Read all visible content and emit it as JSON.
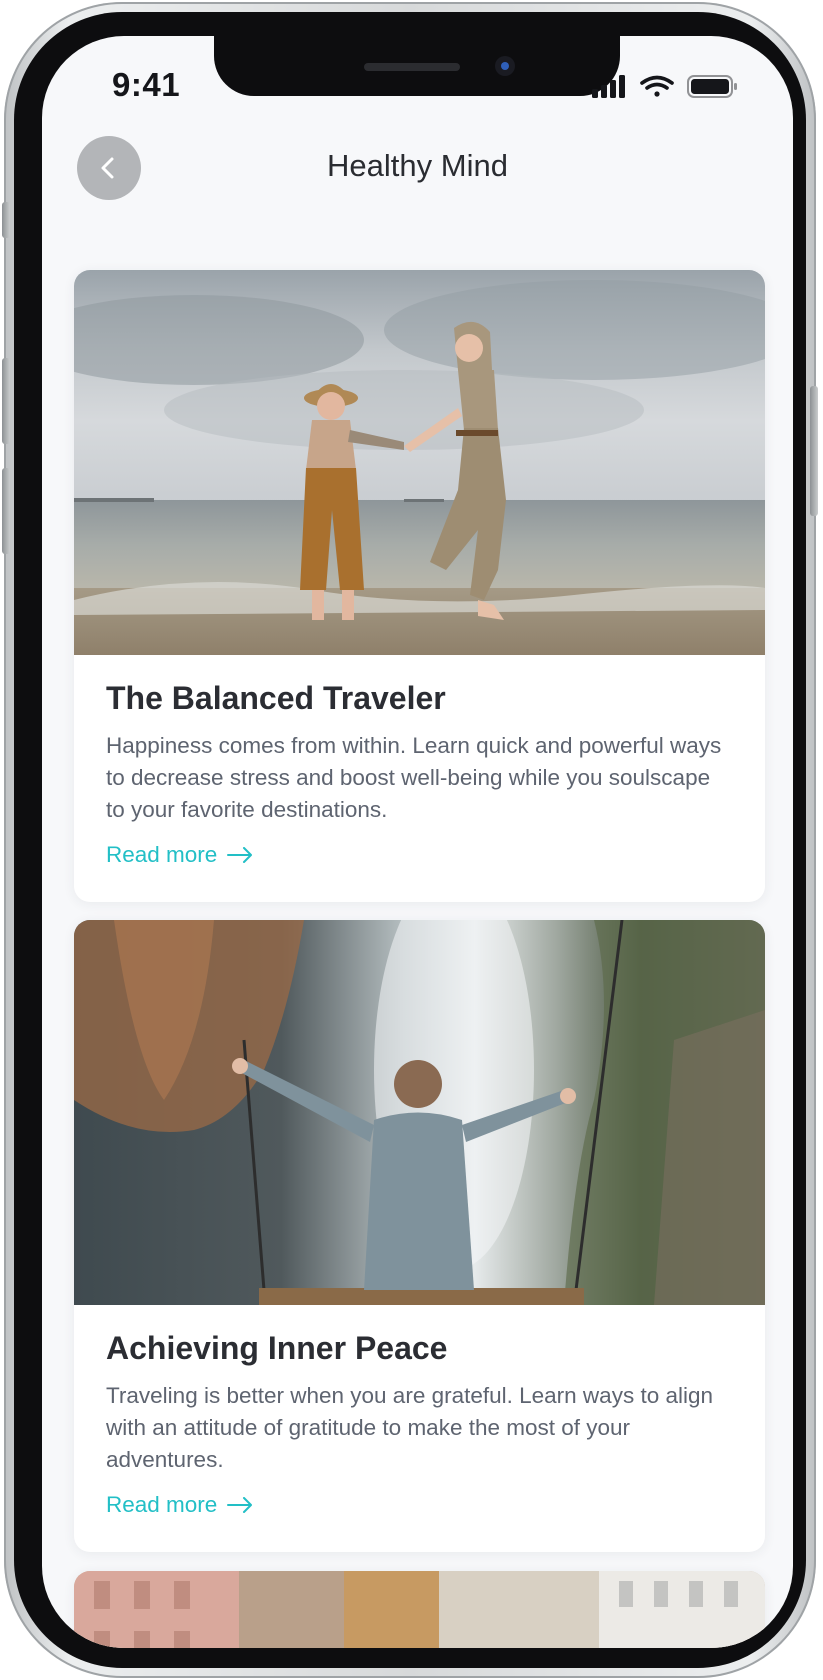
{
  "status_bar": {
    "time": "9:41"
  },
  "header": {
    "title": "Healthy Mind"
  },
  "articles": [
    {
      "title": "The Balanced Traveler",
      "description": "Happiness comes from within. Learn quick and powerful ways to decrease stress and boost well-being while you soulscape to your favorite destinations.",
      "link_label": "Read more"
    },
    {
      "title": "Achieving Inner Peace",
      "description": "Traveling is better when you are grateful. Learn ways to align with an attitude of gratitude to make the most of your adventures.",
      "link_label": "Read more"
    }
  ],
  "colors": {
    "accent": "#22bfc6",
    "title_text": "#2b2d33",
    "body_text": "#5e6470",
    "screen_background": "#f7f8fa",
    "back_button": "#b3b5b8"
  },
  "icons": [
    "chevron-left-icon",
    "signal-icon",
    "wifi-icon",
    "battery-icon",
    "arrow-right-icon"
  ]
}
